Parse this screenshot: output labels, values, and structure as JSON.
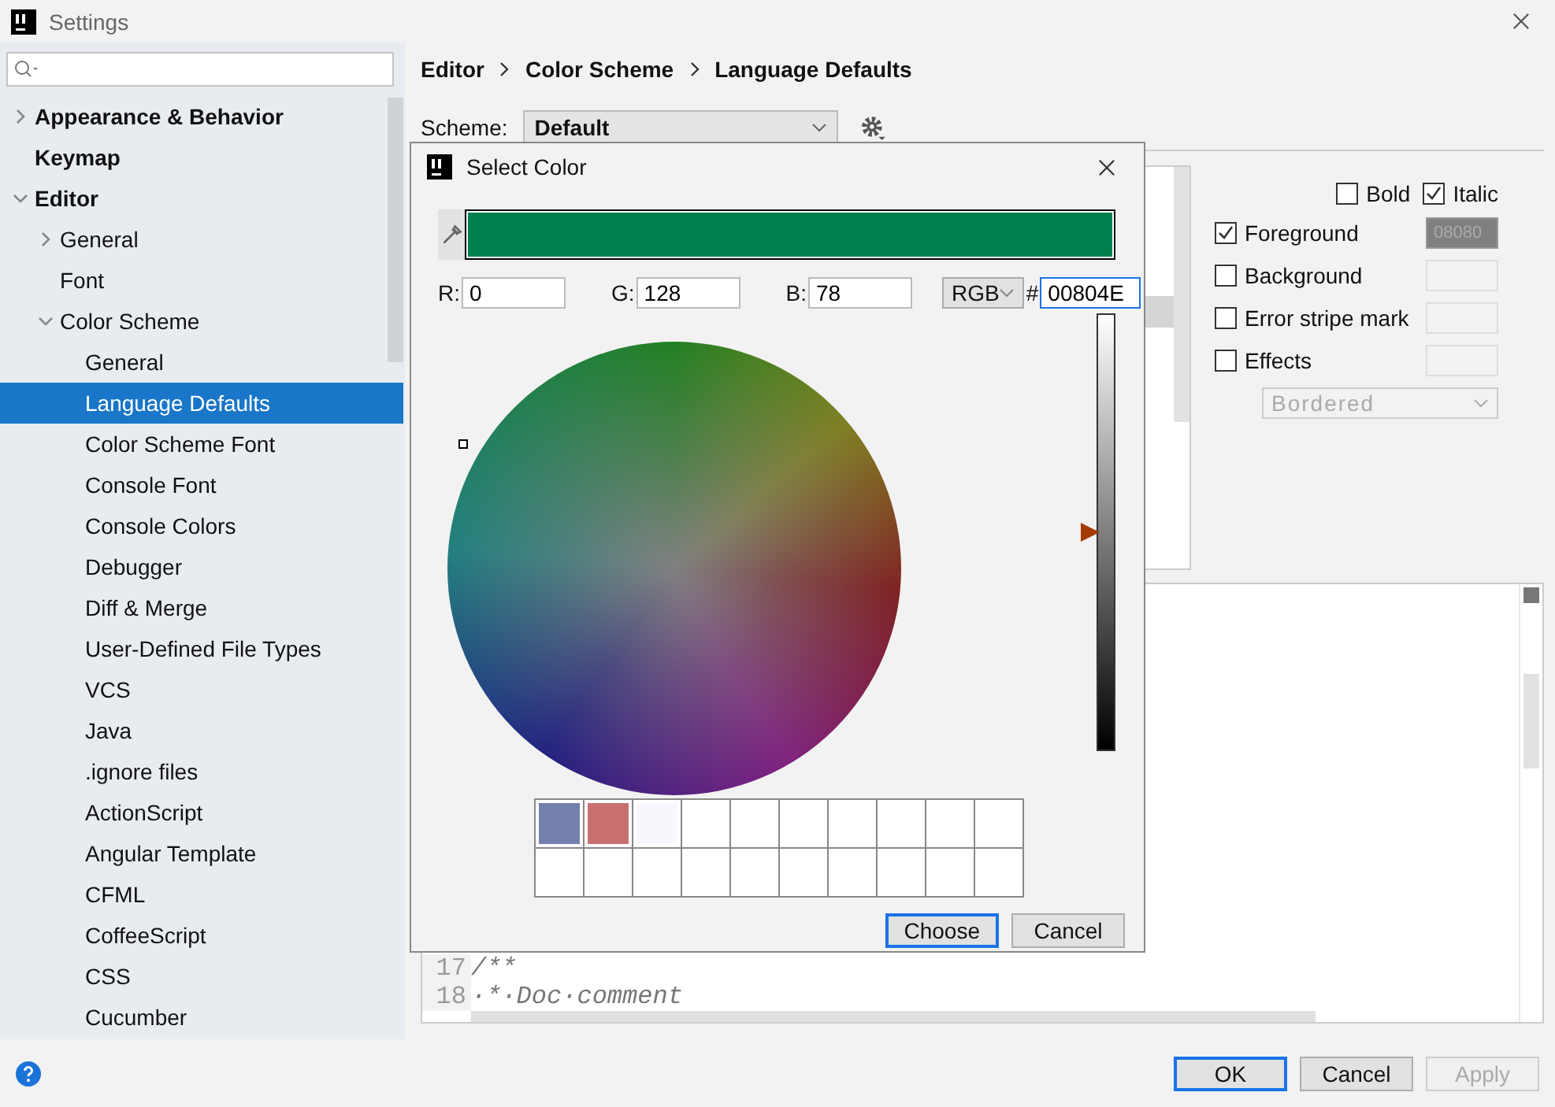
{
  "window": {
    "title": "Settings"
  },
  "tree": [
    {
      "label": "Appearance & Behavior",
      "expanded": false,
      "selected": false
    },
    {
      "label": "Keymap",
      "selected": false
    },
    {
      "label": "Editor",
      "expanded": true,
      "selected": false,
      "children": [
        {
          "label": "General",
          "expanded": false,
          "selected": false
        },
        {
          "label": "Font",
          "selected": false
        },
        {
          "label": "Color Scheme",
          "expanded": true,
          "selected": false,
          "children": [
            {
              "label": "General",
              "selected": false
            },
            {
              "label": "Language Defaults",
              "selected": true
            },
            {
              "label": "Color Scheme Font",
              "selected": false
            },
            {
              "label": "Console Font",
              "selected": false
            },
            {
              "label": "Console Colors",
              "selected": false
            },
            {
              "label": "Debugger",
              "selected": false
            },
            {
              "label": "Diff & Merge",
              "selected": false
            },
            {
              "label": "User-Defined File Types",
              "selected": false
            },
            {
              "label": "VCS",
              "selected": false
            },
            {
              "label": "Java",
              "selected": false
            },
            {
              "label": ".ignore files",
              "selected": false
            },
            {
              "label": "ActionScript",
              "selected": false
            },
            {
              "label": "Angular Template",
              "selected": false
            },
            {
              "label": "CFML",
              "selected": false
            },
            {
              "label": "CoffeeScript",
              "selected": false
            },
            {
              "label": "CSS",
              "selected": false
            },
            {
              "label": "Cucumber",
              "selected": false
            }
          ]
        }
      ]
    }
  ],
  "breadcrumb": [
    "Editor",
    "Color Scheme",
    "Language Defaults"
  ],
  "scheme": {
    "label": "Scheme:",
    "value": "Default"
  },
  "font_style": [
    {
      "label": "Bold",
      "checked": false
    },
    {
      "label": "Italic",
      "checked": true
    }
  ],
  "attributes": [
    {
      "label": "Foreground",
      "checked": true,
      "swatch": "08080",
      "color": "#808080"
    },
    {
      "label": "Background",
      "checked": false
    },
    {
      "label": "Error stripe mark",
      "checked": false
    },
    {
      "label": "Effects",
      "checked": false
    }
  ],
  "effect_type": {
    "value": "Bordered",
    "disabled": true
  },
  "preview": {
    "lines": [
      {
        "number": "17",
        "text": "/**"
      },
      {
        "number": "18",
        "text": "·*·Doc·comment"
      }
    ]
  },
  "dialog": {
    "title": "Select Color",
    "color": "#00804e",
    "channels": [
      {
        "label": "R:",
        "value": "0"
      },
      {
        "label": "G:",
        "value": "128"
      },
      {
        "label": "B:",
        "value": "78"
      }
    ],
    "mode": "RGB",
    "hash": "#",
    "hex": "00804E",
    "brightness": {
      "level": 0.5
    },
    "recent": [
      {
        "color": "#7480ad"
      },
      {
        "color": "#c87070"
      },
      {
        "color": "#f6f8fd"
      },
      {
        "color": "#ffffff"
      },
      {
        "color": "#ffffff"
      },
      {
        "color": "#ffffff"
      },
      {
        "color": "#ffffff"
      },
      {
        "color": "#ffffff"
      },
      {
        "color": "#ffffff"
      },
      {
        "color": "#ffffff"
      },
      {
        "color": "#ffffff"
      },
      {
        "color": "#ffffff"
      },
      {
        "color": "#ffffff"
      },
      {
        "color": "#ffffff"
      },
      {
        "color": "#ffffff"
      },
      {
        "color": "#ffffff"
      },
      {
        "color": "#ffffff"
      },
      {
        "color": "#ffffff"
      },
      {
        "color": "#ffffff"
      },
      {
        "color": "#ffffff"
      }
    ],
    "buttons": [
      {
        "label": "Choose",
        "default": true
      },
      {
        "label": "Cancel",
        "default": false
      }
    ]
  },
  "buttons": [
    {
      "label": "OK",
      "default": true,
      "disabled": false
    },
    {
      "label": "Cancel",
      "default": false,
      "disabled": false
    },
    {
      "label": "Apply",
      "default": false,
      "disabled": true
    }
  ]
}
